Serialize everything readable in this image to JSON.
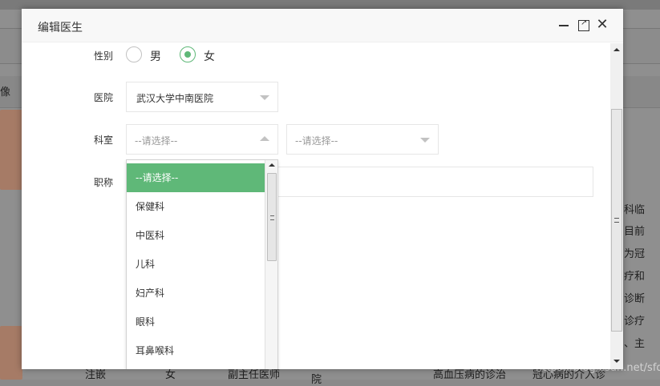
{
  "background": {
    "column_text": "像",
    "right_text": [
      "科临",
      "目前",
      "为冠",
      "疗和",
      "诊断",
      "诊疗",
      "、主"
    ],
    "bottom_row": [
      "注嵌",
      "女",
      "副主任医师",
      "院",
      "高血压病的诊治",
      "冠心病的介入诊"
    ]
  },
  "watermark": "https://blog.csdn.net/sfdly",
  "modal": {
    "title": "编辑医生",
    "fields": {
      "gender": {
        "label": "性别",
        "options": [
          "男",
          "女"
        ],
        "selected": "女"
      },
      "hospital": {
        "label": "医院",
        "value": "武汉大学中南医院"
      },
      "department": {
        "label": "科室",
        "placeholder": "--请选择--",
        "sub_placeholder": "--请选择--"
      },
      "title": {
        "label": "职称"
      }
    },
    "dropdown": {
      "items": [
        "--请选择--",
        "保健科",
        "中医科",
        "儿科",
        "妇产科",
        "眼科",
        "耳鼻喉科"
      ],
      "selected_index": 0
    }
  },
  "colors": {
    "accent": "#5fb878",
    "border": "#e6e6e6"
  }
}
